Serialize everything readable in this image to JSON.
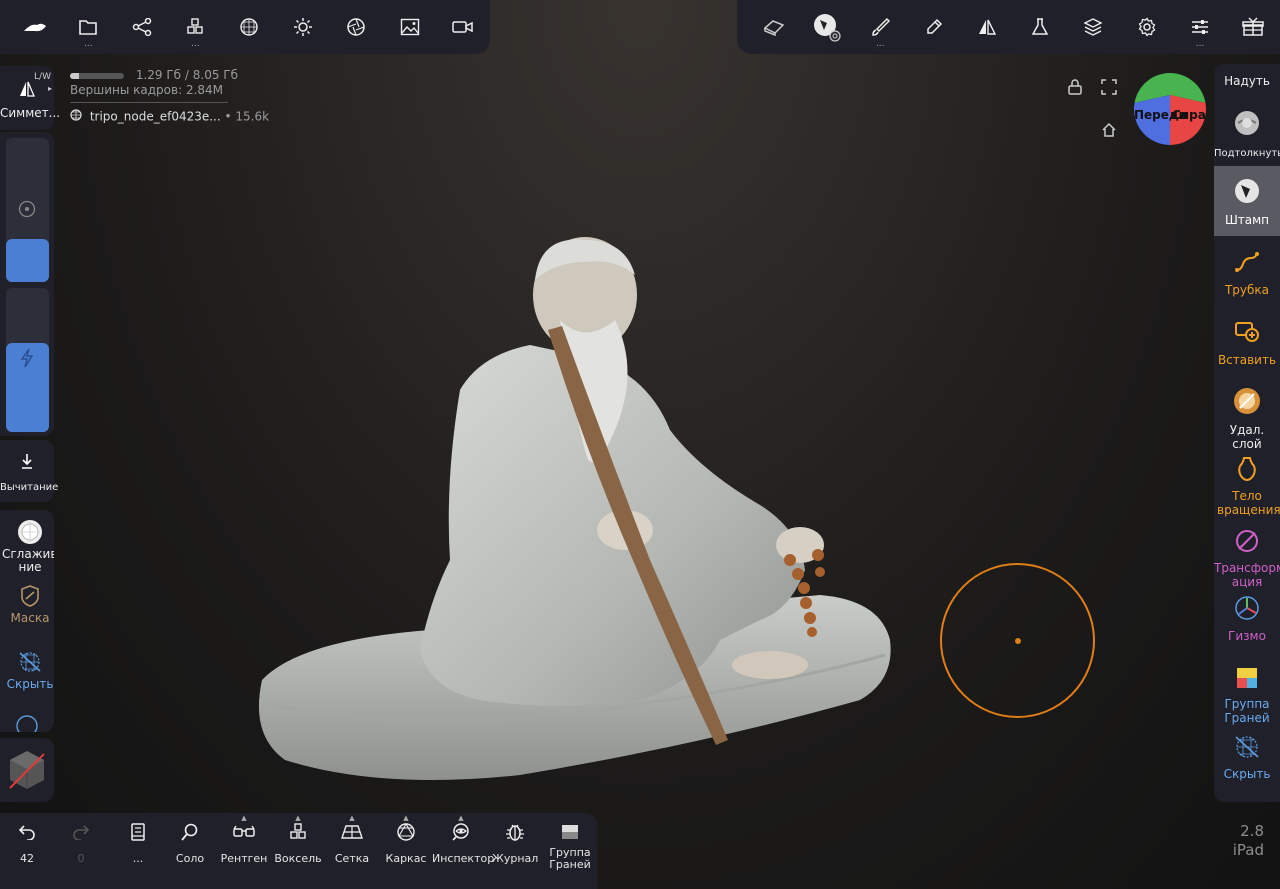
{
  "top_toolbar": {
    "dots": "..."
  },
  "info": {
    "memory": "1.29 Гб / 8.05 Гб",
    "memory_fraction": 0.16,
    "vertices_label": "Вершины кадров:",
    "vertices_value": "2.84M",
    "object_name": "tripo_node_ef0423e...",
    "object_count": "• 15.6k"
  },
  "left_panel": {
    "symmetry_label": "Симмет...",
    "lw_label": "L/W",
    "radius_fill": 0.3,
    "intensity_fill": 0.62,
    "subtract_label": "Вычитание",
    "smooth_label": "Сглажива ние",
    "mask_label": "Маска",
    "hide_label": "Скрыть"
  },
  "right_panel": {
    "tools": [
      {
        "label": "Надуть",
        "icon": "inflate-icon"
      },
      {
        "label": "Подтолкнуть",
        "icon": "nudge-icon"
      },
      {
        "label": "Штамп",
        "icon": "stamp-icon"
      },
      {
        "label": "Трубка",
        "icon": "tube-icon"
      },
      {
        "label": "Вставить",
        "icon": "insert-icon"
      },
      {
        "label": "Удал. слой",
        "icon": "delete-layer-icon"
      },
      {
        "label": "Тело вращения",
        "icon": "lathe-icon"
      },
      {
        "label": "Трансформ ация",
        "icon": "transform-icon"
      },
      {
        "label": "Гизмо",
        "icon": "gizmo-icon"
      },
      {
        "label": "Группа Граней",
        "icon": "facegroup-icon"
      },
      {
        "label": "Скрыть",
        "icon": "hide-icon"
      }
    ],
    "active_tool": "Штамп",
    "accent_color": "#f0a020"
  },
  "view_cube": {
    "front_label": "Переди",
    "right_label": "Справ"
  },
  "bottom_toolbar": {
    "undo_count": "42",
    "redo_count": "0",
    "more_label": "...",
    "items": [
      {
        "label": "Соло"
      },
      {
        "label": "Рентген"
      },
      {
        "label": "Воксель"
      },
      {
        "label": "Сетка"
      },
      {
        "label": "Каркас"
      },
      {
        "label": "Инспектор"
      },
      {
        "label": "Журнал"
      },
      {
        "label": "Группа Граней"
      }
    ]
  },
  "version": {
    "number": "2.8",
    "device": "iPad"
  }
}
